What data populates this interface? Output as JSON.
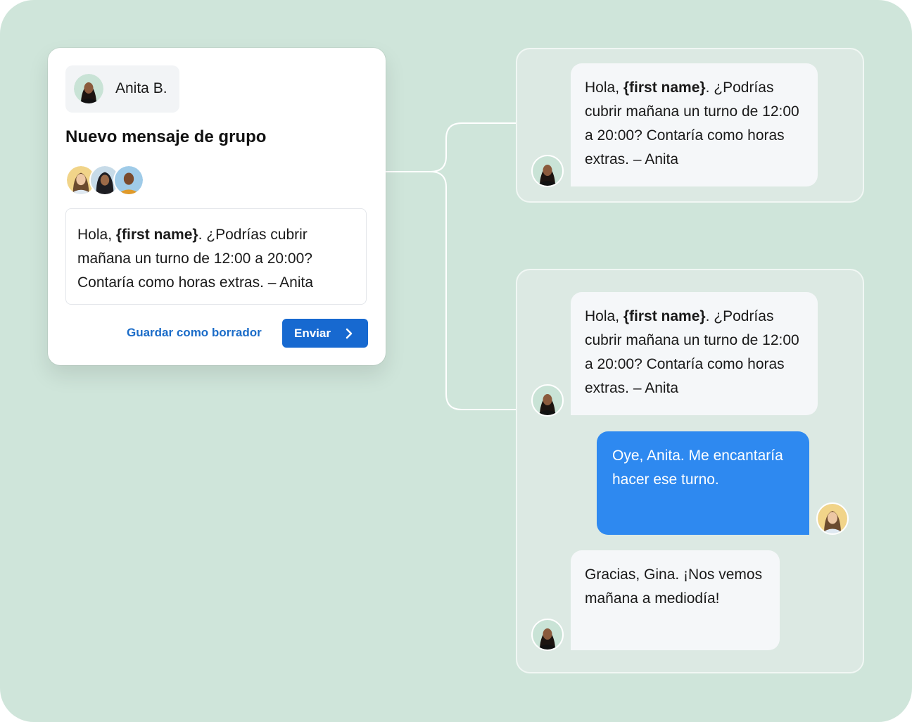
{
  "composer": {
    "sender_name": "Anita B.",
    "title": "Nuevo mensaje de grupo",
    "message_prefix": "Hola, ",
    "message_token": "{first name}",
    "message_suffix": ". ¿Podrías cubrir mañana un turno de 12:00 a 20:00? Contaría como horas extras. – Anita",
    "draft_label": "Guardar como borrador",
    "send_label": "Enviar"
  },
  "thread1": {
    "message_prefix": "Hola, ",
    "message_token": "{first name}",
    "message_suffix": ". ¿Podrías cubrir mañana un turno de 12:00 a 20:00? Contaría como horas extras. – Anita"
  },
  "thread2": {
    "message_prefix": "Hola, ",
    "message_token": "{first name}",
    "message_suffix": ". ¿Podrías cubrir mañana un turno de 12:00 a 20:00? Contaría como horas extras. – Anita",
    "reply": "Oye, Anita. Me encantaría hacer ese turno.",
    "response": "Gracias, Gina. ¡Nos vemos mañana a mediodía!"
  },
  "colors": {
    "background": "#cfe5da",
    "primary_button": "#1769d0",
    "outgoing_bubble": "#2e89f0",
    "link": "#1b6cc8"
  }
}
